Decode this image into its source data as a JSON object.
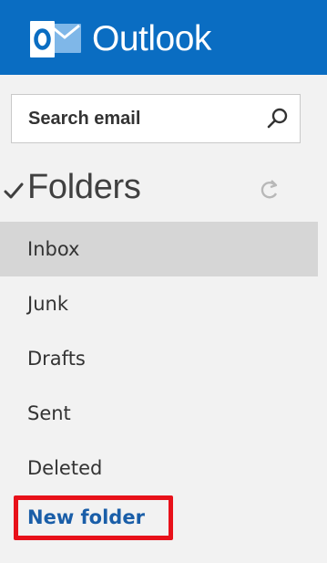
{
  "header": {
    "app_name": "Outlook",
    "logo_letter": "O",
    "background_color": "#0a6dc2"
  },
  "search": {
    "placeholder": "Search email",
    "icon": "search-icon"
  },
  "folders": {
    "title": "Folders",
    "expanded_icon": "checkmark-icon",
    "refresh_icon": "refresh-icon",
    "items": [
      {
        "label": "Inbox",
        "selected": true
      },
      {
        "label": "Junk",
        "selected": false
      },
      {
        "label": "Drafts",
        "selected": false
      },
      {
        "label": "Sent",
        "selected": false
      },
      {
        "label": "Deleted",
        "selected": false
      }
    ],
    "new_folder_label": "New folder"
  },
  "colors": {
    "accent": "#0a6dc2",
    "link": "#1a5ea8",
    "selected_row": "#d6d6d6",
    "pane_background": "#f2f2f2",
    "annotation": "#e8111a"
  }
}
